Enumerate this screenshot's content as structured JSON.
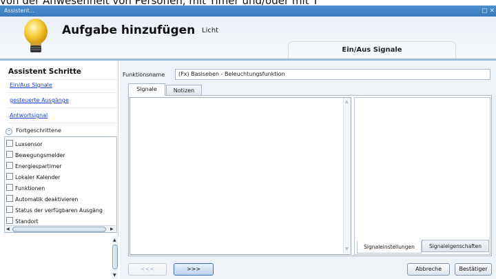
{
  "caption_overflow": "von der Anwesenheit von Personen, mit Timer und/oder mit T",
  "window": {
    "title": "Assistent...",
    "controls": "▢ ✕"
  },
  "header": {
    "title": "Aufgabe hinzufügen",
    "subtitle": "Licht",
    "current_step": "Ein/Aus Signale"
  },
  "sidebar": {
    "heading": "Assistent Schritte",
    "steps": [
      "Ein/Aus Signale",
      "gesteuerte Ausgänge",
      "Antwortsignal"
    ],
    "advanced_label": "Fortgeschrittene",
    "advanced_items": [
      "Luxsensor",
      "Bewegungsmelder",
      "Energiespartimer",
      "Lokaler Kalender",
      "Funktionen",
      "Automatik deaktivieren",
      "Status der verfügbaren Ausgäng",
      "Standort"
    ]
  },
  "main": {
    "function_name_label": "Funktionsname",
    "function_name_value": "(Fx) Basiseben - Beleuchtungsfunktion",
    "tabs": [
      "Signale",
      "Notizen"
    ],
    "bottom_tabs": [
      "Signaleinstellungen",
      "Signaleigenschaften"
    ]
  },
  "buttons": {
    "back": "<<<",
    "next": ">>>",
    "cancel": "Abbreche",
    "confirm": "Bestätiger"
  }
}
